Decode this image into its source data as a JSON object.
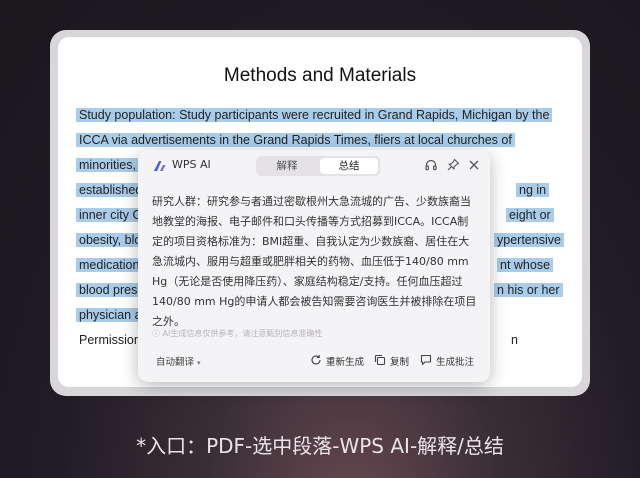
{
  "document": {
    "title": "Methods and Materials",
    "lines": [
      "Study population: Study participants were recruited in Grand Rapids, Michigan by the",
      "ICCA via advertisements in the Grand Rapids Times, fliers at local churches of",
      "minorities,",
      "established",
      "inner city G",
      "obesity, blo",
      "medication",
      "blood press",
      "physician a",
      "Permission"
    ],
    "right_fragments": [
      "ng in",
      "eight or",
      "ypertensive",
      "nt whose",
      "n his or her",
      "n"
    ]
  },
  "popup": {
    "brand": "WPS AI",
    "tabs": [
      "解释",
      "总结"
    ],
    "active_tab": "总结",
    "lines": [
      "研究人群：研究参与者通过密歇根州大急流城的广告、少数族裔当",
      "地教堂的海报、电子邮件和口头传播等方式招募到ICCA。ICCA制",
      "定的项目资格标准为：BMI超重、自我认定为少数族裔、居住在大",
      "急流城内、服用与超重或肥胖相关的药物、血压低于140/80 mm",
      "Hg（无论是否使用降压药）、家庭结构稳定/支持。任何血压超过",
      "140/80 mm Hg的申请人都会被告知需要咨询医生并被排除在项目",
      "之外。"
    ],
    "disclaimer": "AI生成信息仅供参考，请注意甄别信息准确性",
    "auto_translate": "自动翻译",
    "actions": {
      "regenerate": "重新生成",
      "copy": "复制",
      "annotate": "生成批注"
    }
  },
  "caption": "*入口：PDF-选中段落-WPS AI-解释/总结",
  "colors": {
    "highlight": "#a9ccea",
    "popup_bg": "#f4f3f5",
    "frame": "#d9d6da",
    "logo": "#4a5cf0"
  }
}
